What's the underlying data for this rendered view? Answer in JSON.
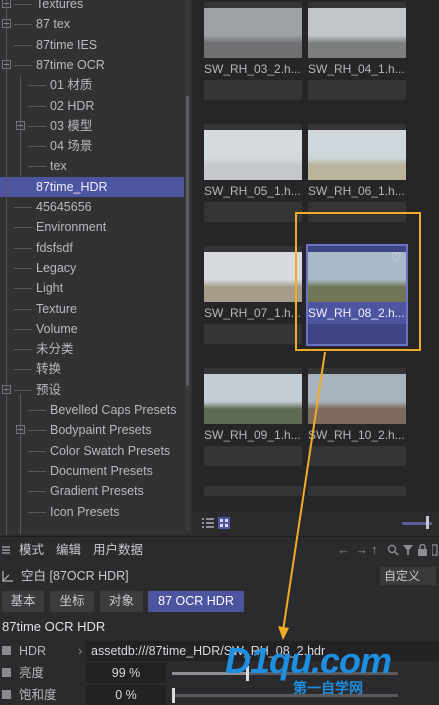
{
  "tree": {
    "items": [
      {
        "label": "Textures",
        "indent": 1,
        "expander": "plus"
      },
      {
        "label": "87 tex",
        "indent": 1,
        "expander": "plus"
      },
      {
        "label": "87time IES",
        "indent": 1,
        "expander": ""
      },
      {
        "label": "87time OCR",
        "indent": 1,
        "expander": "minus"
      },
      {
        "label": "01 材质",
        "indent": 2,
        "expander": ""
      },
      {
        "label": "02 HDR",
        "indent": 2,
        "expander": ""
      },
      {
        "label": "03 模型",
        "indent": 2,
        "expander": "plus"
      },
      {
        "label": "04 场景",
        "indent": 2,
        "expander": ""
      },
      {
        "label": "tex",
        "indent": 2,
        "expander": ""
      },
      {
        "label": "87time_HDR",
        "indent": 1,
        "expander": "",
        "selected": true
      },
      {
        "label": "45645656",
        "indent": 1,
        "expander": ""
      },
      {
        "label": "Environment",
        "indent": 1,
        "expander": ""
      },
      {
        "label": "fdsfsdf",
        "indent": 1,
        "expander": ""
      },
      {
        "label": "Legacy",
        "indent": 1,
        "expander": ""
      },
      {
        "label": "Light",
        "indent": 1,
        "expander": ""
      },
      {
        "label": "Texture",
        "indent": 1,
        "expander": ""
      },
      {
        "label": "Volume",
        "indent": 1,
        "expander": ""
      },
      {
        "label": "未分类",
        "indent": 1,
        "expander": ""
      },
      {
        "label": "转换",
        "indent": 1,
        "expander": ""
      },
      {
        "label": "预设",
        "indent": 1,
        "expander": "minus"
      },
      {
        "label": "Bevelled Caps Presets",
        "indent": 2,
        "expander": ""
      },
      {
        "label": "Bodypaint Presets",
        "indent": 2,
        "expander": "plus"
      },
      {
        "label": "Color Swatch Presets",
        "indent": 2,
        "expander": ""
      },
      {
        "label": "Document Presets",
        "indent": 2,
        "expander": ""
      },
      {
        "label": "Gradient Presets",
        "indent": 2,
        "expander": ""
      },
      {
        "label": "Icon Presets",
        "indent": 2,
        "expander": ""
      }
    ]
  },
  "grid": {
    "tiles": [
      {
        "caption": "SW_RH_03_2.h...",
        "sky": "#9ea2a6",
        "ground": "#6f7072"
      },
      {
        "caption": "SW_RH_04_1.h...",
        "sky": "#c2c6cb",
        "ground": "#7c7f7c"
      },
      {
        "caption": "SW_RH_05_1.h...",
        "sky": "#d5dade",
        "ground": "#c4c8ca"
      },
      {
        "caption": "SW_RH_06_1.h...",
        "sky": "#cfd6dc",
        "ground": "#b8b59c"
      },
      {
        "caption": "SW_RH_07_1.h...",
        "sky": "#d7dbe0",
        "ground": "#a69d8a"
      },
      {
        "caption": "SW_RH_08_2.h...",
        "sky": "#aab9c8",
        "ground": "#6f7656",
        "selected": true,
        "favorite": true
      },
      {
        "caption": "SW_RH_09_1.h...",
        "sky": "#c4ccd4",
        "ground": "#5f6a53"
      },
      {
        "caption": "SW_RH_10_2.h...",
        "sky": "#a9b3bd",
        "ground": "#7d6a5c"
      }
    ]
  },
  "browser_bar": {
    "icons": [
      "list-view-icon",
      "grid-view-icon"
    ]
  },
  "attributes": {
    "menu": [
      "模式",
      "编辑",
      "用户数据"
    ],
    "object_name": "空白 [87OCR HDR]",
    "custom_dropdown": "自定义",
    "tabs": [
      "基本",
      "坐标",
      "对象",
      "87 OCR HDR"
    ],
    "active_tab": "87 OCR HDR",
    "section_title": "87time OCR HDR",
    "params": {
      "hdr_label": "HDR",
      "hdr_value": "assetdb:///87time_HDR/SW_RH_08_2.hdr",
      "brightness_label": "亮度",
      "brightness_value": "99 %",
      "brightness_level": 0.33,
      "saturation_label": "饱和度",
      "saturation_value": "0 %",
      "saturation_level": 0.0
    }
  },
  "watermark": {
    "big": "D1qu.com",
    "small": "第一自学网"
  },
  "colors": {
    "accent": "#4e55a0",
    "highlight": "#f0ac27",
    "watermark": "#1e8fe0"
  }
}
